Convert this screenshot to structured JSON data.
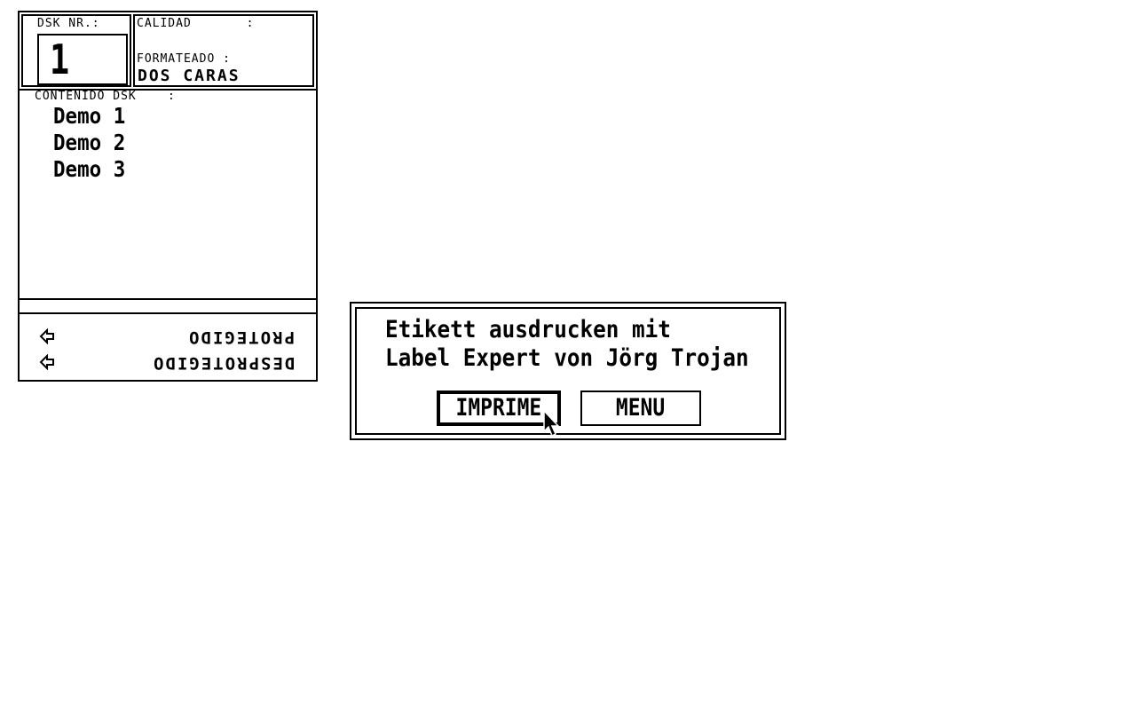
{
  "disk_card": {
    "nr_label": "DSK NR.:",
    "nr_value": "1",
    "calidad_label": "CALIDAD       :",
    "formateado_label": "FORMATEADO :",
    "formateado_value": "DOS CARAS",
    "contents_label": "CONTENIDO DSK    :",
    "contents": [
      "Demo 1",
      "Demo 2",
      "Demo 3"
    ],
    "protect_options": [
      {
        "icon": "left-arrow-icon",
        "label": "PROTEGIDO"
      },
      {
        "icon": "left-arrow-icon",
        "label": "DESPROTEGIDO"
      }
    ]
  },
  "dialog": {
    "message_line_1": "Etikett ausdrucken mit",
    "message_line_2": "Label Expert von Jörg Trojan",
    "print_button": "IMPRIME",
    "menu_button": "MENU"
  },
  "colors": {
    "background": "#ffffff",
    "foreground": "#000000"
  }
}
